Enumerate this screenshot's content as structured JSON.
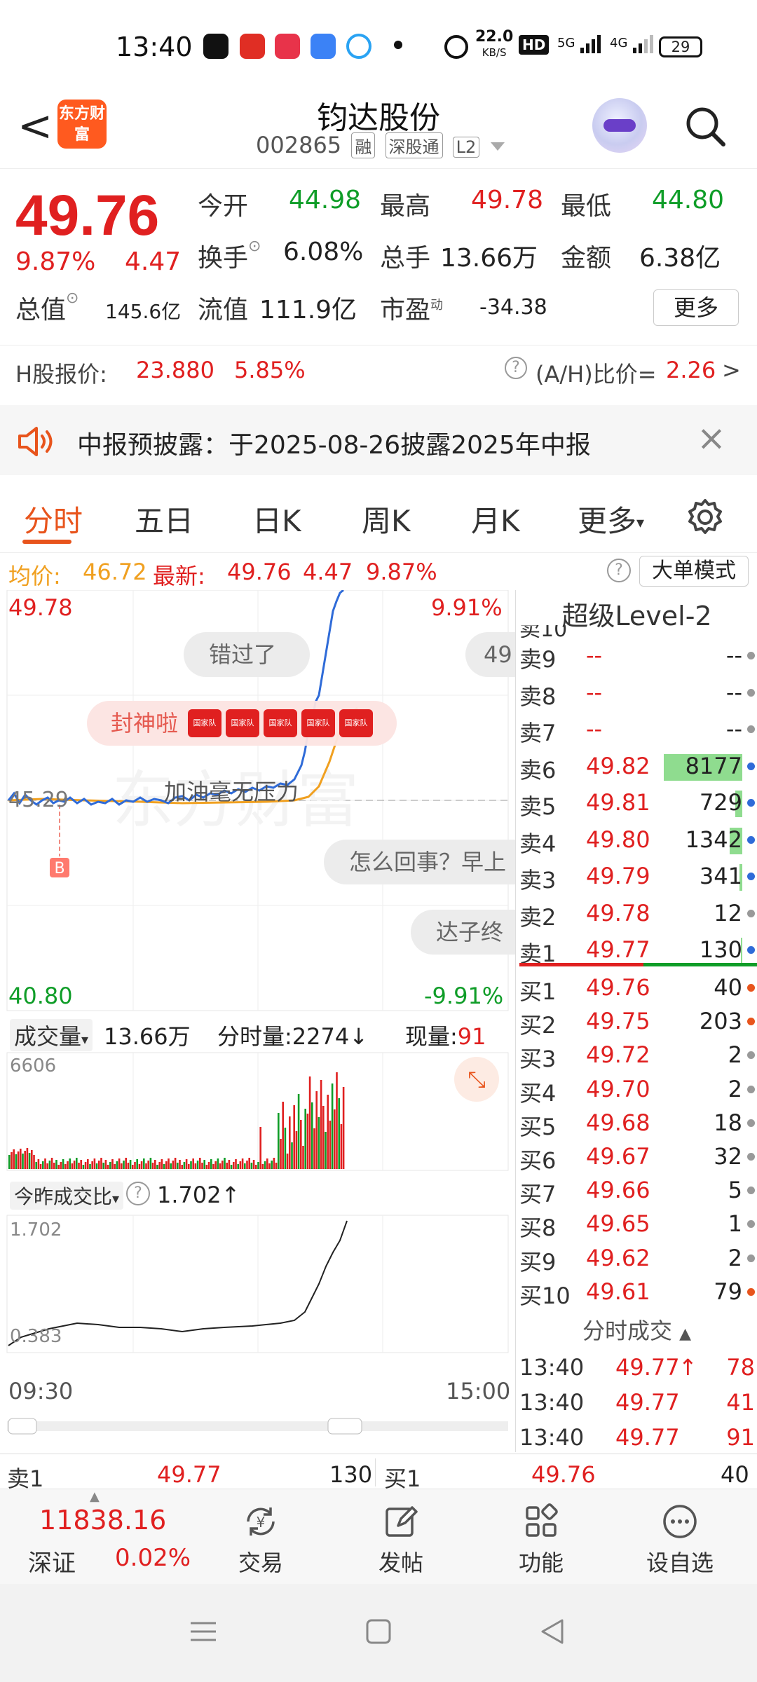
{
  "status_bar": {
    "time": "13:40",
    "net_speed": "22.0",
    "net_unit": "KB/S",
    "hd": "HD",
    "signal1": "5G",
    "signal2": "4G",
    "battery": "29"
  },
  "header": {
    "back": "<",
    "logo": "东方财富",
    "stock_name": "钧达股份",
    "stock_code": "002865",
    "tags": [
      "融",
      "深股通",
      "L2"
    ]
  },
  "quote": {
    "price": "49.76",
    "change_pct": "9.87%",
    "change": "4.47",
    "open_label": "今开",
    "open": "44.98",
    "high_label": "最高",
    "high": "49.78",
    "low_label": "最低",
    "low": "44.80",
    "turnover_label": "换手",
    "turnover": "6.08%",
    "volume_label": "总手",
    "volume": "13.66万",
    "amount_label": "金额",
    "amount": "6.38亿",
    "mktcap_label": "总值",
    "mktcap": "145.6亿",
    "float_label": "流值",
    "float": "111.9亿",
    "pe_label": "市盈",
    "pe_sup": "动",
    "pe": "-34.38",
    "more": "更多"
  },
  "hshare": {
    "label": "H股报价:",
    "price": "23.880",
    "pct": "5.85%",
    "ratio_label": "(A/H)比价=",
    "ratio": "2.26",
    "arrow": ">"
  },
  "notice": {
    "text": "中报预披露：于2025-08-26披露2025年中报",
    "close": "×"
  },
  "tabs": [
    "分时",
    "五日",
    "日K",
    "周K",
    "月K",
    "更多"
  ],
  "avg_line": {
    "avg_label": "均价:",
    "avg": "46.72",
    "latest_label": "最新:",
    "latest": "49.76",
    "change": "4.47",
    "pct": "9.87%",
    "help": "?",
    "big_mode": "大单模式"
  },
  "chart": {
    "top_price": "49.78",
    "top_pct": "9.91%",
    "bottom_price": "40.80",
    "bottom_pct": "-9.91%",
    "prev_close": "45.29",
    "buy_marker": "B",
    "danmu": [
      "错过了",
      "49",
      "封神啦",
      "加油毫无压力",
      "怎么回事？早上",
      "达子终"
    ],
    "danmu_badge": "国家队",
    "volume_label": "成交量",
    "volume_total": "13.66万",
    "tick_volume_label": "分时量:",
    "tick_volume": "2274",
    "current_vol_label": "现量:",
    "current_vol": "91",
    "vol_max": "6606",
    "ratio_label": "今昨成交比",
    "ratio_help": "?",
    "ratio_value": "1.702",
    "ratio_top": "1.702",
    "ratio_bottom": "0.383",
    "time_start": "09:30",
    "time_end": "15:00",
    "watermark": "东方财富"
  },
  "orderbook": {
    "title": "超级Level-2",
    "partial_top": "卖10",
    "sells": [
      {
        "label": "卖9",
        "price": "--",
        "vol": "--",
        "dot": "#999999"
      },
      {
        "label": "卖8",
        "price": "--",
        "vol": "--",
        "dot": "#999999"
      },
      {
        "label": "卖7",
        "price": "--",
        "vol": "--",
        "dot": "#999999"
      },
      {
        "label": "卖6",
        "price": "49.82",
        "vol": "8177",
        "dot": "#2f6bd8",
        "bar": 1.0
      },
      {
        "label": "卖5",
        "price": "49.81",
        "vol": "729",
        "dot": "#2f6bd8",
        "bar": 0.09
      },
      {
        "label": "卖4",
        "price": "49.80",
        "vol": "1342",
        "dot": "#2f6bd8",
        "bar": 0.16
      },
      {
        "label": "卖3",
        "price": "49.79",
        "vol": "341",
        "dot": "#2f6bd8",
        "bar": 0.04
      },
      {
        "label": "卖2",
        "price": "49.78",
        "vol": "12",
        "dot": "#999999",
        "bar": 0.0
      },
      {
        "label": "卖1",
        "price": "49.77",
        "vol": "130",
        "dot": "#2f6bd8",
        "bar": 0.02
      }
    ],
    "buys": [
      {
        "label": "买1",
        "price": "49.76",
        "vol": "40",
        "dot": "#e8541c"
      },
      {
        "label": "买2",
        "price": "49.75",
        "vol": "203",
        "dot": "#e8541c"
      },
      {
        "label": "买3",
        "price": "49.72",
        "vol": "2",
        "dot": "#999999"
      },
      {
        "label": "买4",
        "price": "49.70",
        "vol": "2",
        "dot": "#999999"
      },
      {
        "label": "买5",
        "price": "49.68",
        "vol": "18",
        "dot": "#999999"
      },
      {
        "label": "买6",
        "price": "49.67",
        "vol": "32",
        "dot": "#999999"
      },
      {
        "label": "买7",
        "price": "49.66",
        "vol": "5",
        "dot": "#999999"
      },
      {
        "label": "买8",
        "price": "49.65",
        "vol": "1",
        "dot": "#999999"
      },
      {
        "label": "买9",
        "price": "49.62",
        "vol": "2",
        "dot": "#999999"
      },
      {
        "label": "买10",
        "price": "49.61",
        "vol": "79",
        "dot": "#e8541c"
      }
    ],
    "trades_title": "分时成交",
    "trades": [
      {
        "time": "13:40",
        "price": "49.77",
        "dir": "↑",
        "vol": "78"
      },
      {
        "time": "13:40",
        "price": "49.77",
        "dir": "",
        "vol": "41"
      },
      {
        "time": "13:40",
        "price": "49.77",
        "dir": "",
        "vol": "91"
      }
    ]
  },
  "bid_ask_bar": {
    "sell_label": "卖1",
    "sell_price": "49.77",
    "sell_vol": "130",
    "buy_label": "买1",
    "buy_price": "49.76",
    "buy_vol": "40"
  },
  "bottom_nav": {
    "index_value": "11838.16",
    "index_name": "深证",
    "index_pct": "0.02%",
    "items": [
      "交易",
      "发帖",
      "功能",
      "设自选"
    ]
  },
  "colors": {
    "up": "#e02020",
    "down": "#0f9d28",
    "accent": "#e8541c",
    "line": "#2f6bd8",
    "avg": "#f0a020"
  }
}
